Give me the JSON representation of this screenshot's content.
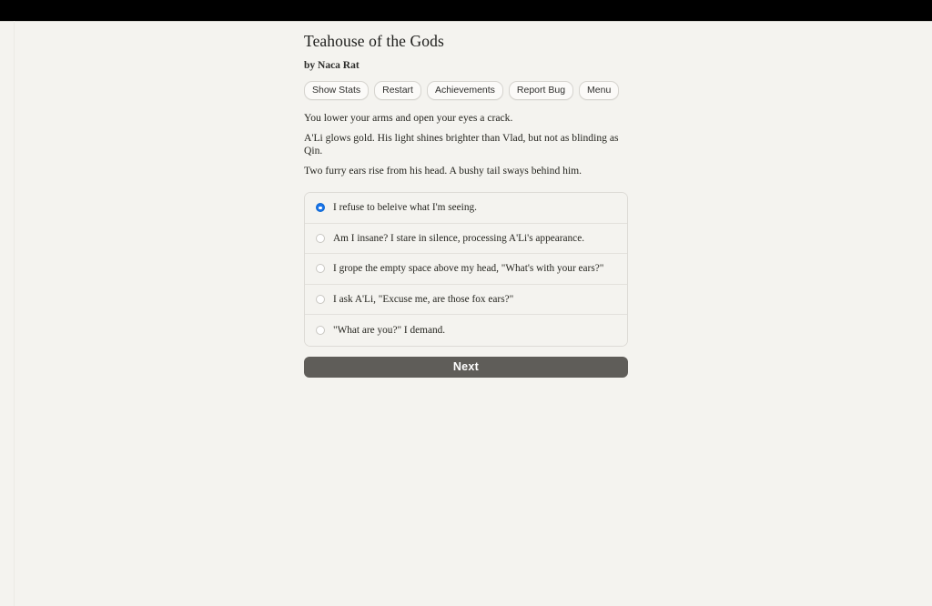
{
  "window": {
    "top_bar_color": "#000000",
    "page_background": "#f4f3ef"
  },
  "header": {
    "title": "Teahouse of the Gods",
    "byline": "by Naca Rat"
  },
  "toolbar": {
    "buttons": [
      {
        "label": "Show Stats",
        "name": "show-stats-button"
      },
      {
        "label": "Restart",
        "name": "restart-button"
      },
      {
        "label": "Achievements",
        "name": "achievements-button"
      },
      {
        "label": "Report Bug",
        "name": "report-bug-button"
      },
      {
        "label": "Menu",
        "name": "menu-button"
      }
    ]
  },
  "story": {
    "paragraphs": [
      "You lower your arms and open your eyes a crack.",
      "A'Li glows gold. His light shines brighter than Vlad, but not as blinding as Qin.",
      "Two furry ears rise from his head. A bushy tail sways behind him."
    ]
  },
  "choices": {
    "selected_index": 0,
    "options": [
      {
        "label": "I refuse to beleive what I'm seeing.",
        "selected": true
      },
      {
        "label": "Am I insane? I stare in silence, processing A'Li's appearance.",
        "selected": false
      },
      {
        "label": "I grope the empty space above my head, \"What's with your ears?\"",
        "selected": false
      },
      {
        "label": "I ask A'Li, \"Excuse me, are those fox ears?\"",
        "selected": false
      },
      {
        "label": "\"What are you?\" I demand.",
        "selected": false
      }
    ]
  },
  "actions": {
    "next_label": "Next",
    "next_color": "#5f5d59"
  }
}
